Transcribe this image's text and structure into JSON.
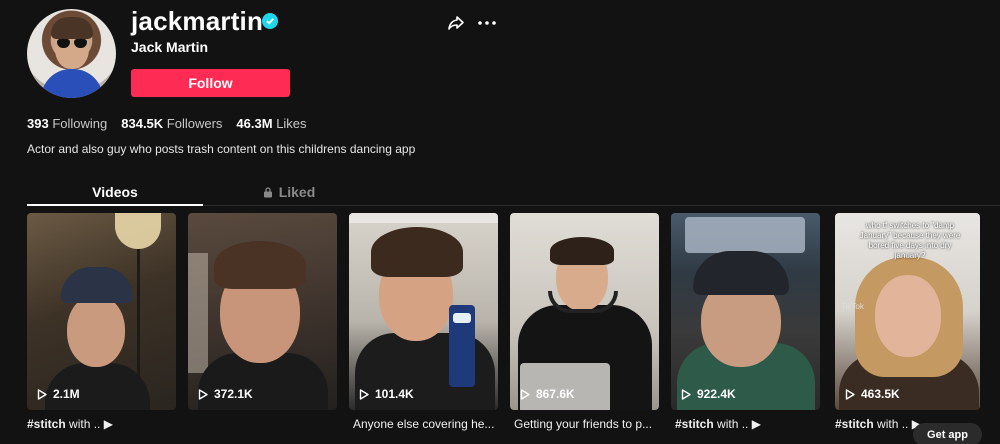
{
  "profile": {
    "username": "jackmartin",
    "nickname": "Jack Martin",
    "follow_label": "Follow",
    "bio": "Actor and also guy who posts trash content on this childrens dancing app"
  },
  "stats": {
    "following_count": "393",
    "following_label": "Following",
    "followers_count": "834.5K",
    "followers_label": "Followers",
    "likes_count": "46.3M",
    "likes_label": "Likes"
  },
  "tabs": {
    "videos": "Videos",
    "liked": "Liked"
  },
  "videos": [
    {
      "views": "2.1M",
      "caption_tag": "#stitch",
      "caption_rest": " with ..",
      "has_play": true
    },
    {
      "views": "372.1K",
      "caption_tag": "",
      "caption_rest": "",
      "has_play": false
    },
    {
      "views": "101.4K",
      "caption_tag": "",
      "caption_rest": "Anyone else covering he...",
      "has_play": false
    },
    {
      "views": "867.6K",
      "caption_tag": "",
      "caption_rest": "Getting your friends to p...",
      "has_play": false
    },
    {
      "views": "922.4K",
      "caption_tag": "#stitch",
      "caption_rest": " with ..",
      "has_play": true
    },
    {
      "views": "463.5K",
      "caption_tag": "#stitch",
      "caption_rest": " with ..",
      "has_play": true,
      "overlay": "who tf switches to \"damp January\" because they were bored five days into dry january?",
      "watermark": "TikTok"
    }
  ],
  "get_app": "Get app",
  "colors": {
    "accent": "#fe2c55",
    "verified": "#20d5ec",
    "background": "#121212"
  }
}
